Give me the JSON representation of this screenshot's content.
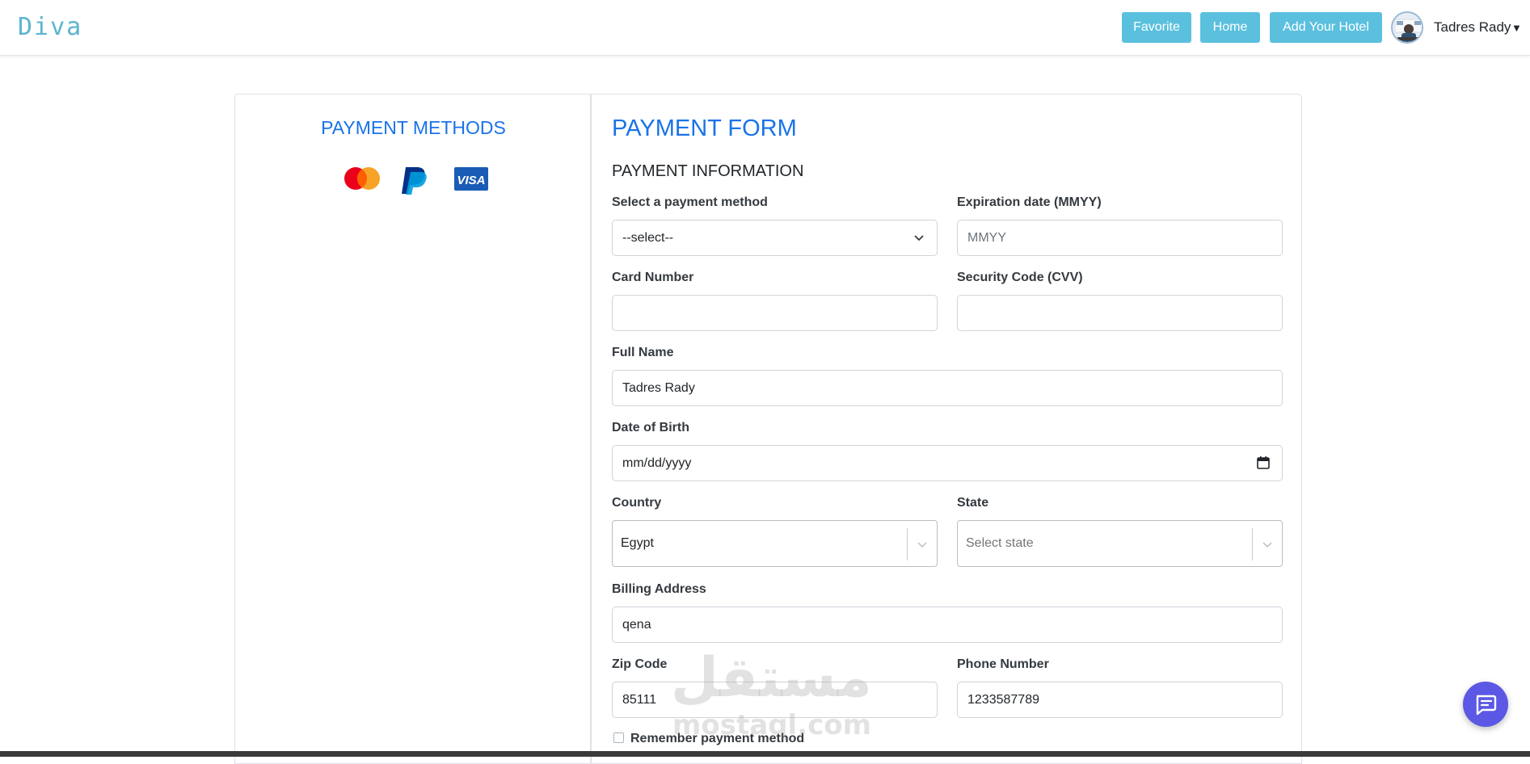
{
  "navbar": {
    "brand": "Diva",
    "buttons": {
      "favorite": "Favorite",
      "home": "Home",
      "add_hotel": "Add Your Hotel"
    },
    "user": {
      "name": "Tadres Rady",
      "caret": "▼"
    }
  },
  "payment_methods": {
    "title": "PAYMENT METHODS",
    "icons": [
      "mastercard-icon",
      "paypal-icon",
      "visa-icon"
    ],
    "visa_text": "VISA"
  },
  "form": {
    "title": "PAYMENT FORM",
    "section": "PAYMENT INFORMATION",
    "payment_method": {
      "label": "Select a payment method",
      "value": "--select--"
    },
    "expiration": {
      "label": "Expiration date (MMYY)",
      "placeholder": "MMYY"
    },
    "card_number": {
      "label": "Card Number",
      "value": ""
    },
    "cvv": {
      "label": "Security Code (CVV)",
      "value": ""
    },
    "full_name": {
      "label": "Full Name",
      "value": "Tadres Rady"
    },
    "dob": {
      "label": "Date of Birth",
      "placeholder": "mm/dd/yyyy"
    },
    "country": {
      "label": "Country",
      "value": "Egypt"
    },
    "state": {
      "label": "State",
      "placeholder": "Select state"
    },
    "billing": {
      "label": "Billing Address",
      "value": "qena"
    },
    "zip": {
      "label": "Zip Code",
      "value": "85111"
    },
    "phone": {
      "label": "Phone Number",
      "value": "1233587789"
    },
    "remember": {
      "label": "Remember payment method",
      "checked": false
    }
  },
  "watermark": {
    "arabic": "مستقل",
    "latin": "mostaql.com"
  },
  "colors": {
    "brand": "#5bb5cf",
    "nav_button": "#5bc0de",
    "heading_blue": "#1a73e8",
    "chat_button": "#5b58e6"
  }
}
